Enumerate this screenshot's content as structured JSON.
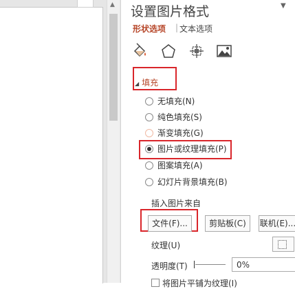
{
  "pane": {
    "title": "设置图片格式",
    "tabs": [
      {
        "label": "形状选项"
      },
      {
        "separator": "|"
      },
      {
        "label": "文本选项"
      }
    ],
    "icons": [
      "fill-line-icon",
      "effects-pentagon-icon",
      "size-properties-icon",
      "picture-icon"
    ]
  },
  "fill": {
    "section_label": "填充",
    "options": [
      {
        "label": "无填充(N)",
        "state": "unchecked"
      },
      {
        "label": "纯色填充(S)",
        "state": "unchecked"
      },
      {
        "label": "渐变填充(G)",
        "state": "faded"
      },
      {
        "label": "图片或纹理填充(P)",
        "state": "checked"
      },
      {
        "label": "图案填充(A)",
        "state": "unchecked"
      },
      {
        "label": "幻灯片背景填充(B)",
        "state": "unchecked"
      }
    ],
    "insert_from_label": "插入图片来自",
    "buttons": {
      "file": "文件(F)...",
      "clipboard": "剪贴板(C)",
      "online": "联机(E)..."
    },
    "texture_label": "纹理(U)",
    "transparency_label": "透明度(T)",
    "transparency_value": "0%",
    "tile_label": "将图片平铺为纹理(I)"
  },
  "colors": {
    "accent": "#b7472a",
    "highlight_box": "#d9252a"
  }
}
